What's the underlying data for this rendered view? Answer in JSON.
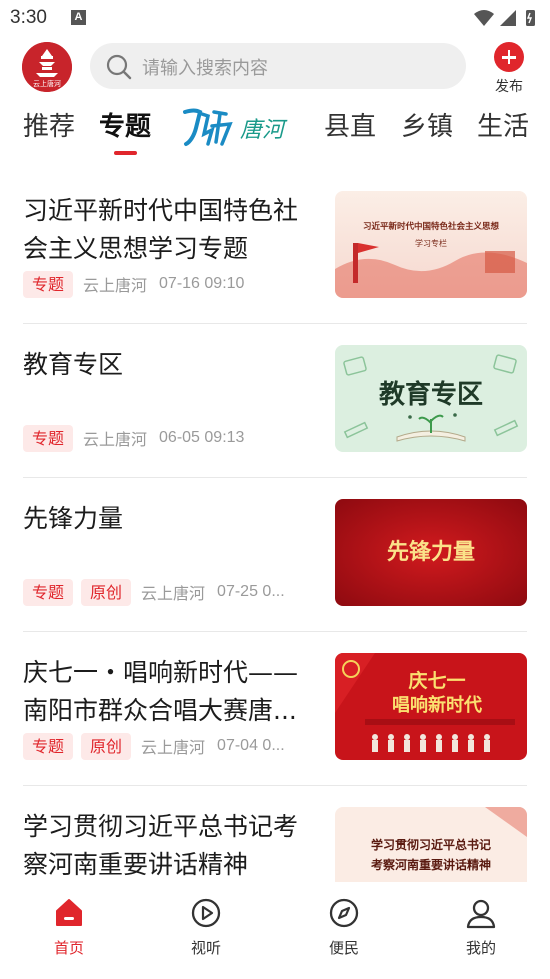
{
  "status_bar": {
    "time": "3:30",
    "notification_icon": "A"
  },
  "header": {
    "logo_icon": "tanghe-logo-icon",
    "logo_text": "云上唐河",
    "search": {
      "placeholder": "请输入搜索内容"
    },
    "publish_label": "发布"
  },
  "tabs": {
    "items": [
      {
        "label": "推荐",
        "active": false
      },
      {
        "label": "专题",
        "active": true
      },
      {
        "label": "县直",
        "active": false
      },
      {
        "label": "乡镇",
        "active": false
      },
      {
        "label": "生活",
        "active": false
      }
    ],
    "brand_text": "唐河"
  },
  "feed": [
    {
      "title": "习近平新时代中国特色社会主义思想学习专题",
      "badges": [
        "专题"
      ],
      "source": "云上唐河",
      "time": "07-16 09:10",
      "thumb_text": "习近平新时代中国特色社会主义思想",
      "thumb_subtext": "学习专栏"
    },
    {
      "title": "教育专区",
      "badges": [
        "专题"
      ],
      "source": "云上唐河",
      "time": "06-05 09:13",
      "thumb_text": "教育专区"
    },
    {
      "title": "先锋力量",
      "badges": [
        "专题",
        "原创"
      ],
      "source": "云上唐河",
      "time": "07-25 0...",
      "thumb_text": "先锋力量"
    },
    {
      "title": "庆七一・唱响新时代——南阳市群众合唱大赛唐...",
      "badges": [
        "专题",
        "原创"
      ],
      "source": "云上唐河",
      "time": "07-04 0...",
      "thumb_text": "庆七一",
      "thumb_subtext": "唱响新时代"
    },
    {
      "title": "学习贯彻习近平总书记考察河南重要讲话精神",
      "badges": [],
      "source": "",
      "time": "",
      "thumb_text": "学习贯彻习近平总书记",
      "thumb_subtext": "考察河南重要讲话精神"
    }
  ],
  "bottom_nav": [
    {
      "label": "首页",
      "icon": "home-icon",
      "active": true
    },
    {
      "label": "视听",
      "icon": "play-icon",
      "active": false
    },
    {
      "label": "便民",
      "icon": "compass-icon",
      "active": false
    },
    {
      "label": "我的",
      "icon": "user-icon",
      "active": false
    }
  ],
  "colors": {
    "accent": "#e0262c",
    "badge_bg": "#fde9e8",
    "text_muted": "#9a9a9a"
  }
}
